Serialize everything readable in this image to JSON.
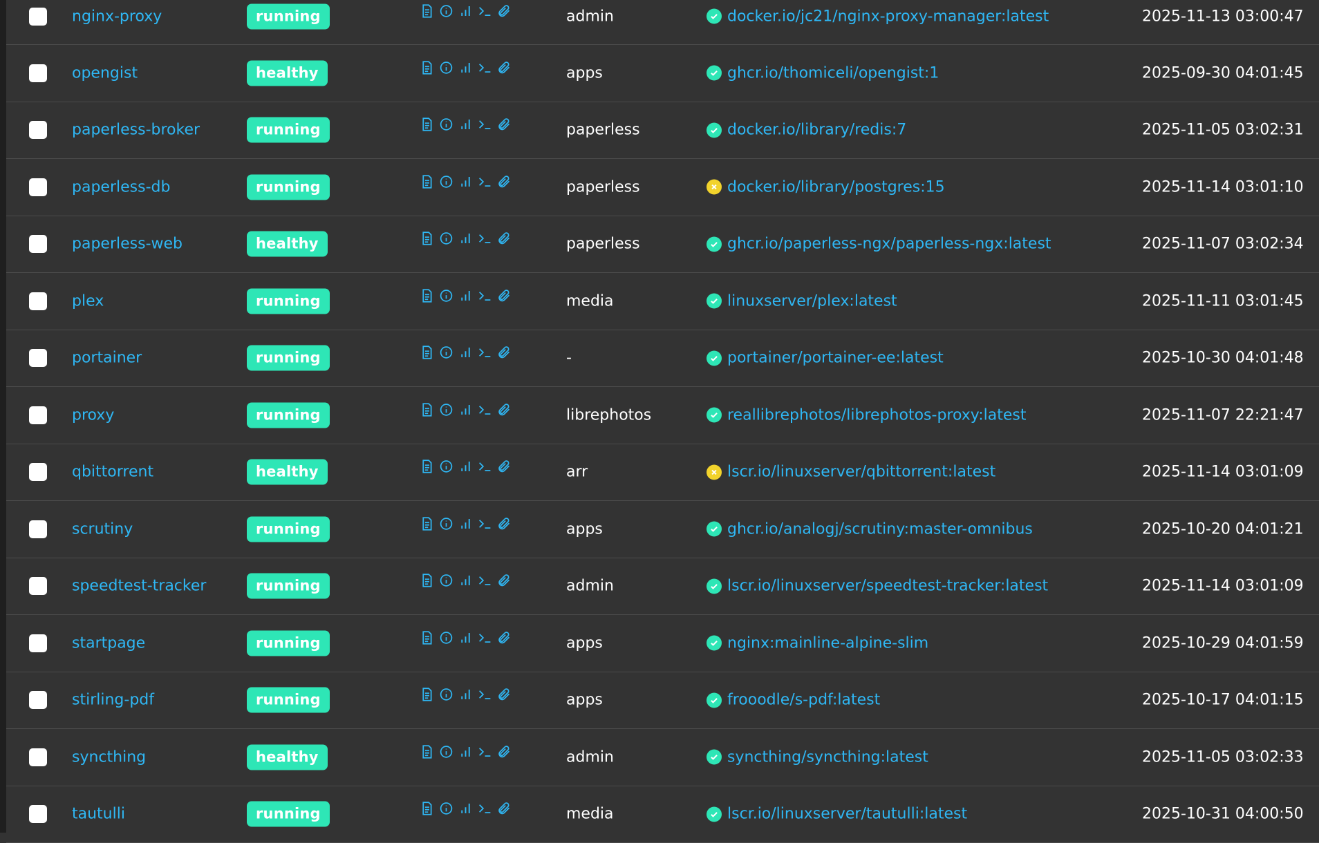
{
  "colors": {
    "background": "#333333",
    "link": "#2fb7f4",
    "status_badge": "#2ee6b6",
    "update_ok": "#2ee6b6",
    "update_warning": "#f2d32c"
  },
  "quick_action_icons": [
    "logs-icon",
    "inspect-icon",
    "stats-icon",
    "console-icon",
    "attach-icon"
  ],
  "containers": [
    {
      "name": "nginx-proxy",
      "state": "running",
      "stack": "admin",
      "image": "docker.io/jc21/nginx-proxy-manager:latest",
      "image_status": "ok",
      "created": "2025-11-13 03:00:47"
    },
    {
      "name": "opengist",
      "state": "healthy",
      "stack": "apps",
      "image": "ghcr.io/thomiceli/opengist:1",
      "image_status": "ok",
      "created": "2025-09-30 04:01:45"
    },
    {
      "name": "paperless-broker",
      "state": "running",
      "stack": "paperless",
      "image": "docker.io/library/redis:7",
      "image_status": "ok",
      "created": "2025-11-05 03:02:31"
    },
    {
      "name": "paperless-db",
      "state": "running",
      "stack": "paperless",
      "image": "docker.io/library/postgres:15",
      "image_status": "warning",
      "created": "2025-11-14 03:01:10"
    },
    {
      "name": "paperless-web",
      "state": "healthy",
      "stack": "paperless",
      "image": "ghcr.io/paperless-ngx/paperless-ngx:latest",
      "image_status": "ok",
      "created": "2025-11-07 03:02:34"
    },
    {
      "name": "plex",
      "state": "running",
      "stack": "media",
      "image": "linuxserver/plex:latest",
      "image_status": "ok",
      "created": "2025-11-11 03:01:45"
    },
    {
      "name": "portainer",
      "state": "running",
      "stack": "-",
      "image": "portainer/portainer-ee:latest",
      "image_status": "ok",
      "created": "2025-10-30 04:01:48"
    },
    {
      "name": "proxy",
      "state": "running",
      "stack": "librephotos",
      "image": "reallibrephotos/librephotos-proxy:latest",
      "image_status": "ok",
      "created": "2025-11-07 22:21:47"
    },
    {
      "name": "qbittorrent",
      "state": "healthy",
      "stack": "arr",
      "image": "lscr.io/linuxserver/qbittorrent:latest",
      "image_status": "warning",
      "created": "2025-11-14 03:01:09"
    },
    {
      "name": "scrutiny",
      "state": "running",
      "stack": "apps",
      "image": "ghcr.io/analogj/scrutiny:master-omnibus",
      "image_status": "ok",
      "created": "2025-10-20 04:01:21"
    },
    {
      "name": "speedtest-tracker",
      "state": "running",
      "stack": "admin",
      "image": "lscr.io/linuxserver/speedtest-tracker:latest",
      "image_status": "ok",
      "created": "2025-11-14 03:01:09"
    },
    {
      "name": "startpage",
      "state": "running",
      "stack": "apps",
      "image": "nginx:mainline-alpine-slim",
      "image_status": "ok",
      "created": "2025-10-29 04:01:59"
    },
    {
      "name": "stirling-pdf",
      "state": "running",
      "stack": "apps",
      "image": "frooodle/s-pdf:latest",
      "image_status": "ok",
      "created": "2025-10-17 04:01:15"
    },
    {
      "name": "syncthing",
      "state": "healthy",
      "stack": "admin",
      "image": "syncthing/syncthing:latest",
      "image_status": "ok",
      "created": "2025-11-05 03:02:33"
    },
    {
      "name": "tautulli",
      "state": "running",
      "stack": "media",
      "image": "lscr.io/linuxserver/tautulli:latest",
      "image_status": "ok",
      "created": "2025-10-31 04:00:50"
    }
  ]
}
